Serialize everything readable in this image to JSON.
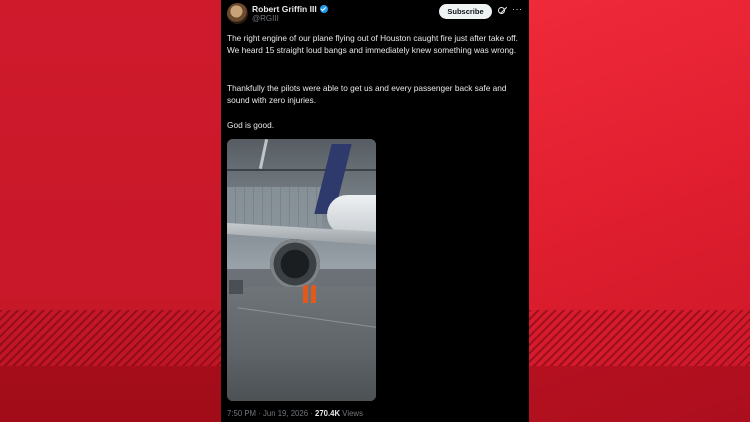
{
  "author": {
    "name": "Robert Griffin III",
    "handle": "@RGIII",
    "verified": true
  },
  "actions": {
    "subscribe_label": "Subscribe",
    "grok_icon": "grok-icon",
    "more_icon": "more-icon",
    "more_glyph": "···"
  },
  "tweet": {
    "paragraphs": [
      "The right engine of our plane flying out of Houston caught fire just after take off. We heard 15 straight loud bangs and immediately knew something was wrong.",
      "Thankfully the pilots were able to get us and every passenger back safe and sound with zero injuries.",
      "God is good."
    ]
  },
  "media": {
    "type": "photo"
  },
  "meta": {
    "timestamp": "7:50 PM · Jun 19, 2026 · ",
    "views_count": "270.4K",
    "views_label": " Views"
  },
  "colors": {
    "background_red": "#d31a2e",
    "card_background": "#000000",
    "text_primary": "#e7e9ea",
    "text_secondary": "#71767b",
    "verified_blue": "#1d9bf0"
  }
}
